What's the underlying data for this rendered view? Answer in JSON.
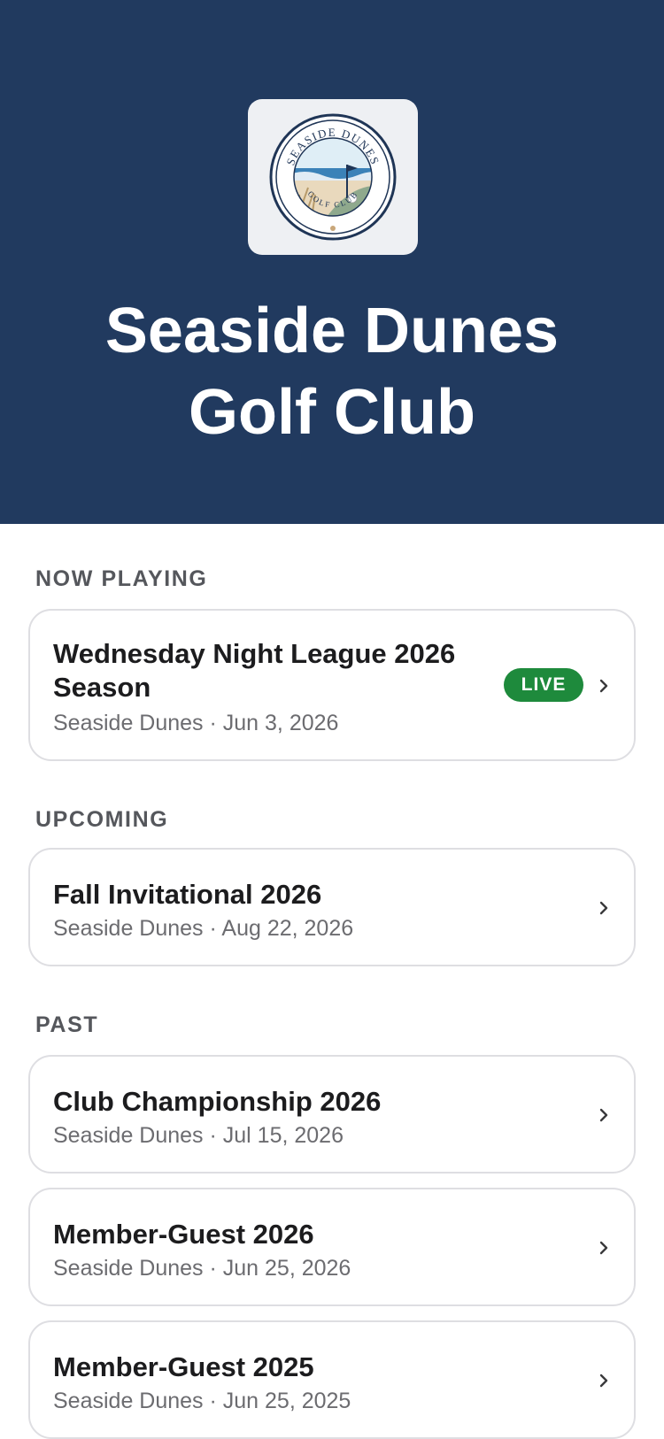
{
  "header": {
    "club_name_line1": "Seaside Dunes",
    "club_name_line2": "Golf Club",
    "logo_text_top": "SEASIDE DUNES",
    "logo_text_bottom": "GOLF CLUB",
    "background_color": "#213a5f"
  },
  "sections": {
    "now_playing": {
      "label": "NOW PLAYING",
      "events": [
        {
          "title_line1": "Wednesday Night League 2026",
          "title_line2": "Season",
          "subtitle": "Seaside Dunes · Jun 3, 2026",
          "badge": "LIVE",
          "badge_color": "#1e8a3c"
        }
      ]
    },
    "upcoming": {
      "label": "UPCOMING",
      "events": [
        {
          "title": "Fall Invitational 2026",
          "subtitle": "Seaside Dunes · Aug 22, 2026"
        }
      ]
    },
    "past": {
      "label": "PAST",
      "events": [
        {
          "title": "Club Championship 2026",
          "subtitle": "Seaside Dunes · Jul 15, 2026"
        },
        {
          "title": "Member-Guest 2026",
          "subtitle": "Seaside Dunes · Jun 25, 2026"
        },
        {
          "title": "Member-Guest 2025",
          "subtitle": "Seaside Dunes · Jun 25, 2025"
        }
      ]
    }
  },
  "icons": {
    "chevron": "chevron-right-icon",
    "logo": "club-logo-icon"
  }
}
